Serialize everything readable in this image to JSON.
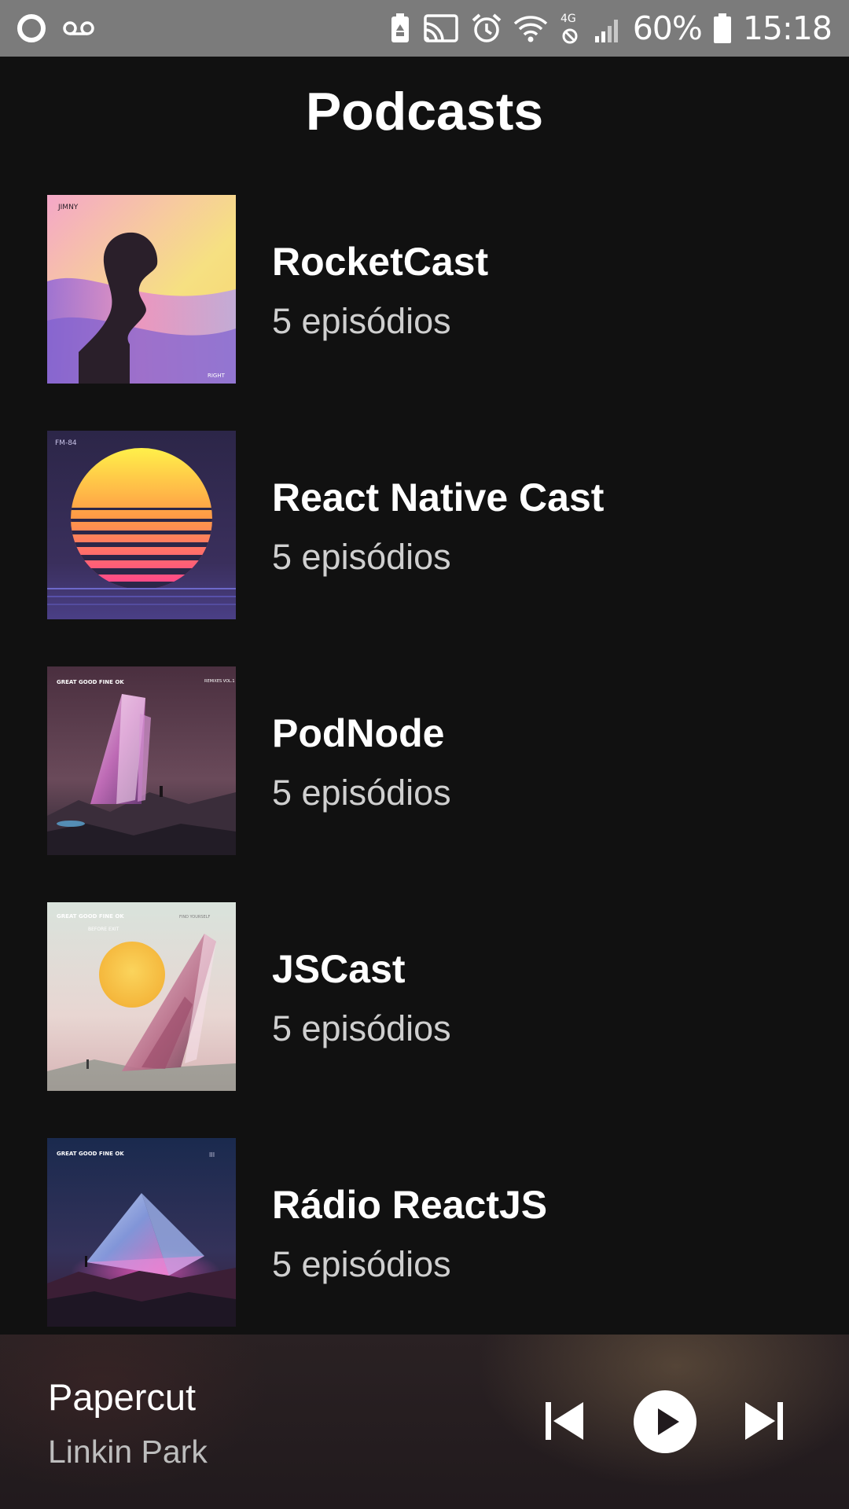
{
  "status_bar": {
    "battery_percent": "60%",
    "time": "15:18",
    "network_label": "4G",
    "icons": [
      "circle-icon",
      "voicemail-icon",
      "battery-saver-icon",
      "cast-icon",
      "alarm-icon",
      "wifi-icon",
      "data-blocked-icon",
      "signal-icon",
      "battery-icon"
    ]
  },
  "header": {
    "title": "Podcasts"
  },
  "podcasts": [
    {
      "title": "RocketCast",
      "episodes": "5 episódios",
      "cover": {
        "art": "profile-silhouette",
        "top_left_text": "JIMNY",
        "bottom_right_text": "RIGHT"
      }
    },
    {
      "title": "React Native Cast",
      "episodes": "5 episódios",
      "cover": {
        "art": "retro-sunset",
        "top_left_text": "FM-84"
      }
    },
    {
      "title": "PodNode",
      "episodes": "5 episódios",
      "cover": {
        "art": "crystal-landscape",
        "top_left_text": "GREAT GOOD FINE OK",
        "top_right_text": "REMIXES VOL.1"
      }
    },
    {
      "title": "JSCast",
      "episodes": "5 episódios",
      "cover": {
        "art": "sun-crystal",
        "top_left_text": "GREAT GOOD FINE OK",
        "top_middle_text": "BEFORE EXIT",
        "top_right_text": "FIND YOURSELF"
      }
    },
    {
      "title": "Rádio ReactJS",
      "episodes": "5 episódios",
      "cover": {
        "art": "glowing-pyramid",
        "top_left_text": "GREAT GOOD FINE OK",
        "top_right_text": "III"
      }
    }
  ],
  "player": {
    "track": "Papercut",
    "artist": "Linkin Park",
    "controls": [
      "skip-previous-icon",
      "play-icon",
      "skip-next-icon"
    ]
  },
  "colors": {
    "background": "#111111",
    "status_bar": "#7b7b7b",
    "title_text": "#ffffff",
    "secondary_text": "#cfcfcf"
  }
}
